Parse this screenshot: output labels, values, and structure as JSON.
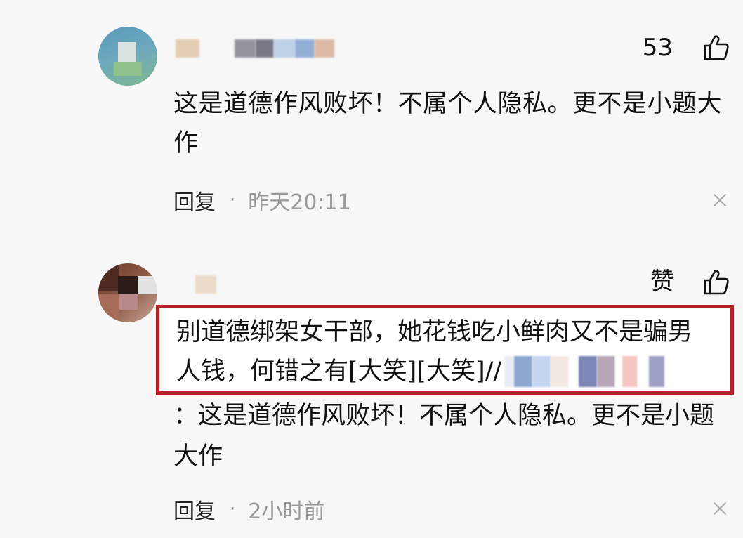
{
  "comments": [
    {
      "like_label": "53",
      "text": "这是道德作风败坏！不属个人隐私。更不是小题大作",
      "reply_label": "回复",
      "separator": "·",
      "time": "昨天20:11"
    },
    {
      "like_label": "赞",
      "text_line1": "别道德绑架女干部，她花钱吃小鲜肉又不是骗男",
      "text_line2": "人钱，何错之有[大笑][大笑]//",
      "quote_text": "：这是道德作风败坏！不属个人隐私。更不是小题大作",
      "reply_label": "回复",
      "separator": "·",
      "time": "2小时前"
    }
  ],
  "colors": {
    "highlight_border": "#b5232a",
    "background": "#f7f7f7",
    "time_text": "#999999"
  },
  "icons": {
    "like": "thumbs-up-icon",
    "dismiss": "close-icon"
  }
}
